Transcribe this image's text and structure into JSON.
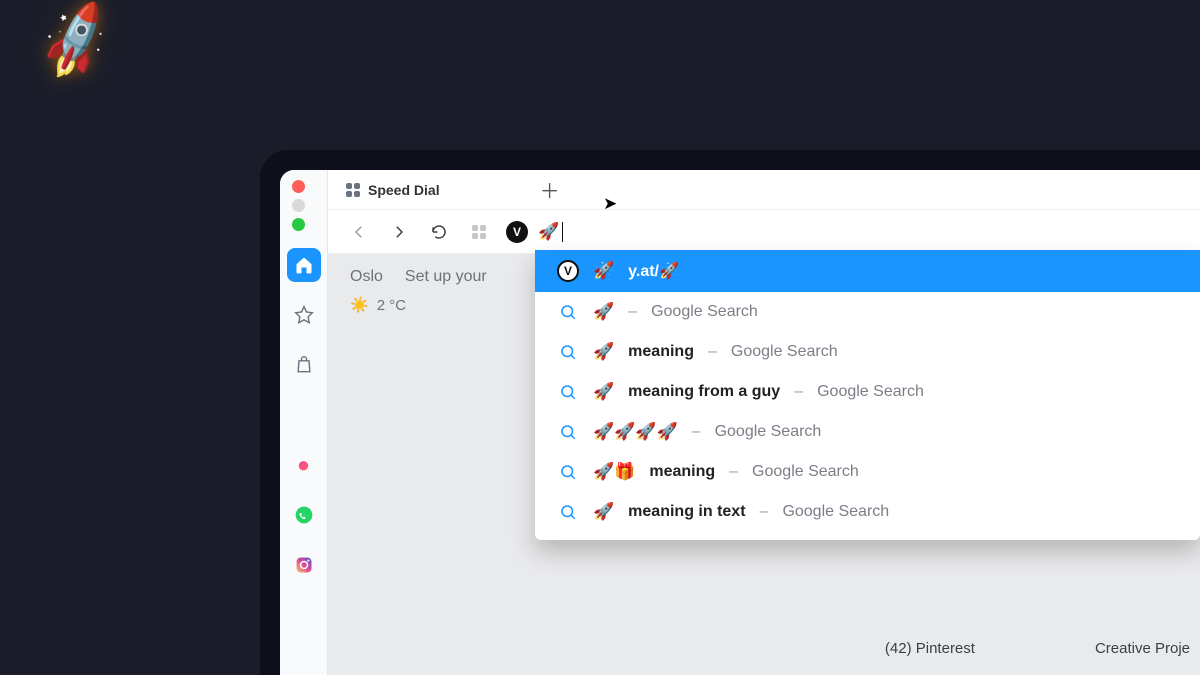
{
  "decor": {
    "rocket_emoji": "🚀"
  },
  "window_controls": [
    "close",
    "minimize",
    "maximize"
  ],
  "tab": {
    "title": "Speed Dial"
  },
  "startpage": {
    "city": "Oslo",
    "setup_prompt": "Set up your",
    "temp": "2 °C",
    "tiles": [
      "(42) Pinterest",
      "Creative Proje"
    ]
  },
  "sidebar": [
    {
      "name": "home",
      "kind": "svg-home",
      "active": true
    },
    {
      "name": "bookmarks",
      "kind": "svg-star",
      "active": false
    },
    {
      "name": "shopping",
      "kind": "svg-bag",
      "active": false
    },
    {
      "name": "spacer",
      "kind": "spacer",
      "active": false
    },
    {
      "name": "messenger",
      "kind": "emoji",
      "glyph": "💬",
      "active": false
    },
    {
      "name": "whatsapp",
      "kind": "emoji",
      "glyph": "🟢",
      "active": false
    },
    {
      "name": "instagram",
      "kind": "emoji",
      "glyph": "📷",
      "active": false
    }
  ],
  "address_bar": {
    "site_badge": "V",
    "input_value": "🚀"
  },
  "suggestions": [
    {
      "icon": "site",
      "emoji": "🚀",
      "term": "y.at/🚀",
      "source": "",
      "selected": true
    },
    {
      "icon": "search",
      "emoji": "🚀",
      "term": "",
      "source": "Google Search"
    },
    {
      "icon": "search",
      "emoji": "🚀",
      "term": "meaning",
      "source": "Google Search"
    },
    {
      "icon": "search",
      "emoji": "🚀",
      "term": "meaning from a guy",
      "source": "Google Search"
    },
    {
      "icon": "search",
      "emoji": "🚀🚀🚀🚀",
      "term": "",
      "source": "Google Search"
    },
    {
      "icon": "search",
      "emoji": "🚀🎁",
      "term": "meaning",
      "source": "Google Search"
    },
    {
      "icon": "search",
      "emoji": "🚀",
      "term": "meaning in text",
      "source": "Google Search"
    }
  ]
}
